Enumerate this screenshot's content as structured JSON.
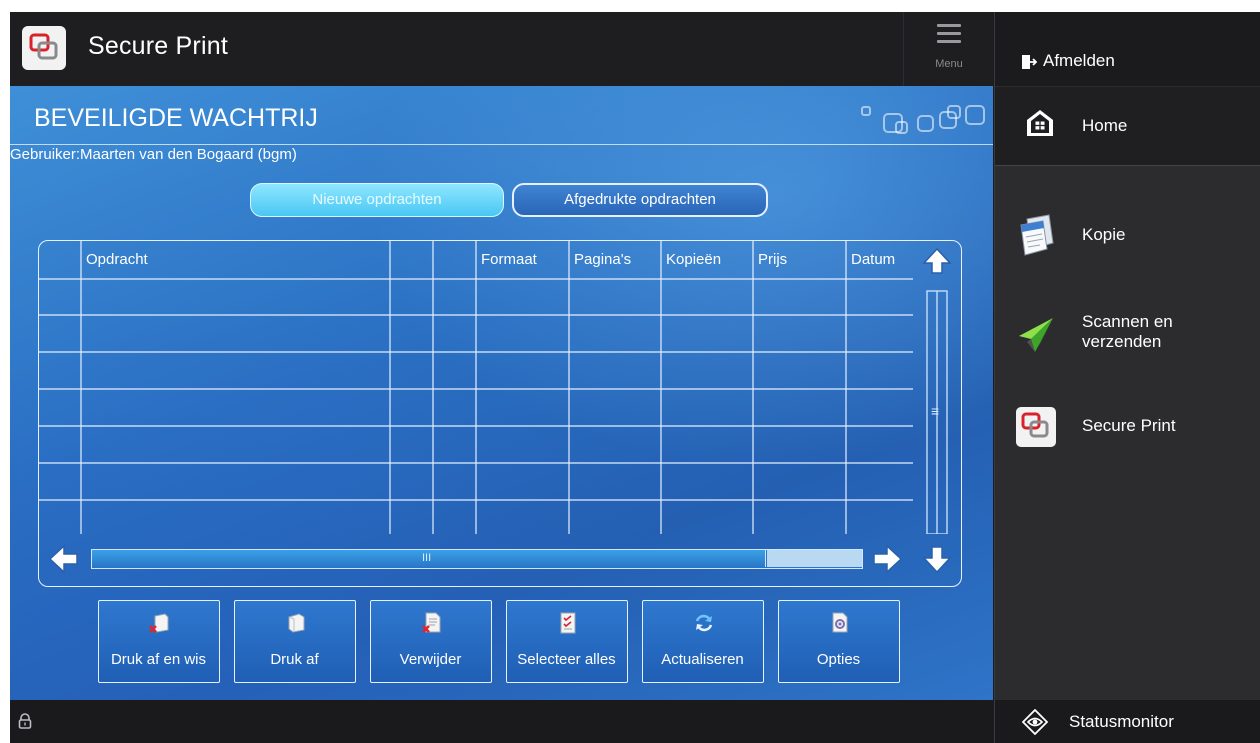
{
  "app": {
    "title": "Secure Print",
    "menu_label": "Menu"
  },
  "queue": {
    "title": "BEVEILIGDE WACHTRIJ",
    "user": "Gebruiker:Maarten van den Bogaard (bgm)"
  },
  "tabs": {
    "new": "Nieuwe opdrachten",
    "printed": "Afgedrukte opdrachten"
  },
  "table": {
    "columns": [
      "Opdracht",
      "",
      "",
      "Formaat",
      "Pagina's",
      "Kopieën",
      "Prijs",
      "Datum"
    ],
    "rows": [],
    "vscroll_grip": "≡",
    "hscroll_grip": "III"
  },
  "actions": {
    "print_delete": "Druk af en wis",
    "print": "Druk af",
    "delete": "Verwijder",
    "select_all": "Selecteer alles",
    "refresh": "Actualiseren",
    "options": "Opties"
  },
  "sidebar": {
    "logout": "Afmelden",
    "home": "Home",
    "items": [
      {
        "label": "Kopie",
        "icon": "copy-icon"
      },
      {
        "label": "Scannen en\nverzenden",
        "icon": "scan-send-icon"
      },
      {
        "label": "Secure Print",
        "icon": "secure-print-icon"
      }
    ],
    "status": "Statusmonitor"
  },
  "colors": {
    "content_bg": "#2a6fc2",
    "active_tab": "#49c7f3",
    "header_bg": "#1e1e20",
    "sidebar_bg": "#2c2c2f"
  }
}
